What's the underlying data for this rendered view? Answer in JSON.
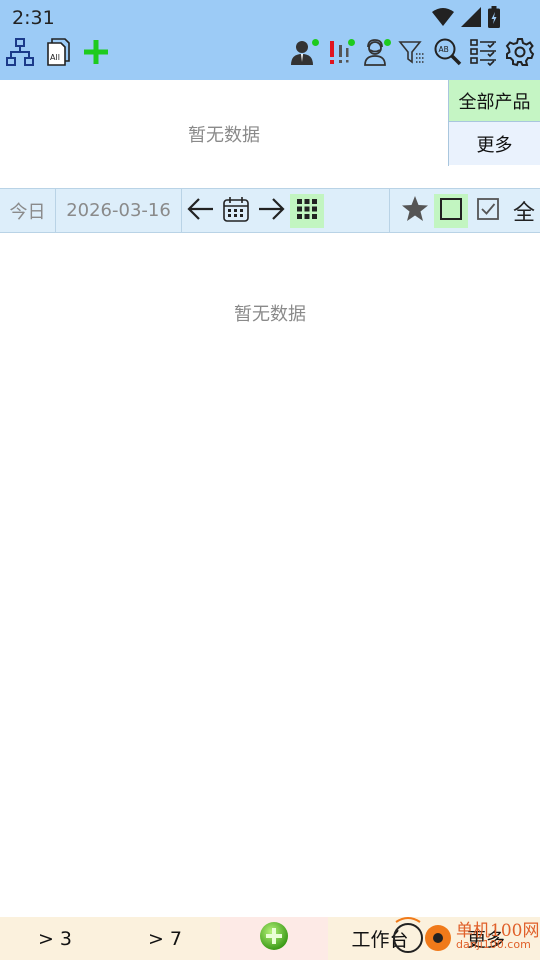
{
  "status_bar": {
    "time": "2:31"
  },
  "product_panel": {
    "empty_text": "暂无数据",
    "all_products_label": "全部产品",
    "more_label": "更多"
  },
  "date_bar": {
    "today_label": "今日",
    "date_value": "2026-03-16",
    "all_label": "全"
  },
  "main": {
    "empty_text": "暂无数据"
  },
  "bottom_nav": {
    "within_3": "> 3",
    "within_7": "> 7",
    "work_label": "工作台",
    "more_label": "更多"
  },
  "watermark": {
    "text": "单机100网",
    "url_text": "danji100.com"
  },
  "colors": {
    "header_bg": "#9ccbf6",
    "accent_green": "#1ecb1e",
    "highlight_green": "#c2f5c1",
    "date_bar_bg": "#ddeefa",
    "bottom_nav_bg": "#fbf1dd",
    "add_tab_bg": "#fdeae6"
  },
  "icons": {
    "toolbar_left": [
      "org-chart-icon",
      "all-files-icon",
      "add-icon"
    ],
    "toolbar_right": [
      "user-online-icon",
      "alert-icon",
      "service-user-icon",
      "filter-icon",
      "ab-search-icon",
      "checklist-icon",
      "gear-icon"
    ]
  }
}
